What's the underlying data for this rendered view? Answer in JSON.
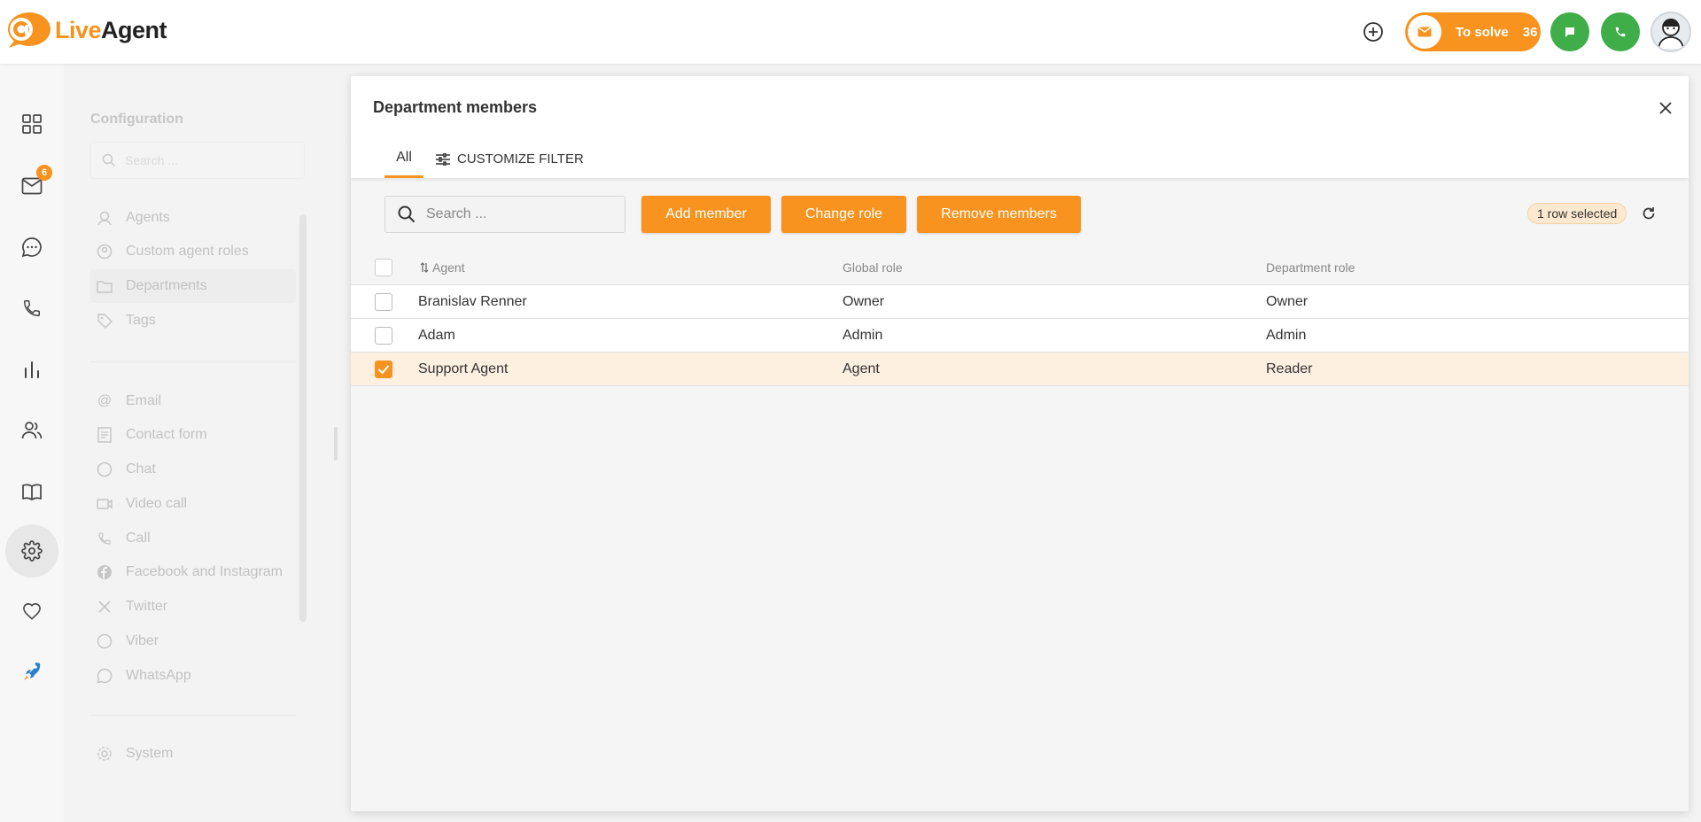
{
  "header": {
    "logo_live": "Live",
    "logo_agent": "Agent",
    "to_solve_label": "To solve",
    "to_solve_count": "36"
  },
  "rail": {
    "inbox_badge": "6",
    "items": [
      "dashboard-icon",
      "inbox-icon",
      "chat-icon",
      "phone-icon",
      "reports-icon",
      "contacts-icon",
      "knowledgebase-icon",
      "settings-icon",
      "heart-icon",
      "rocket-icon"
    ]
  },
  "config": {
    "title": "Configuration",
    "search_placeholder": "Search ...",
    "group1": [
      "Agents",
      "Custom agent roles",
      "Departments",
      "Tags"
    ],
    "group2": [
      "Email",
      "Contact form",
      "Chat",
      "Video call",
      "Call",
      "Facebook and Instagram",
      "Twitter",
      "Viber",
      "WhatsApp"
    ],
    "group3": [
      "System"
    ]
  },
  "modal": {
    "title": "Department members",
    "tab_all": "All",
    "customize_filter": "CUSTOMIZE FILTER",
    "search_placeholder": "Search ...",
    "add_member": "Add member",
    "change_role": "Change role",
    "remove_members": "Remove members",
    "rows_selected": "1 row selected"
  },
  "table": {
    "columns": [
      "Agent",
      "Global role",
      "Department role"
    ],
    "rows": [
      {
        "agent": "Branislav Renner",
        "global_role": "Owner",
        "department_role": "Owner",
        "selected": false
      },
      {
        "agent": "Adam",
        "global_role": "Admin",
        "department_role": "Admin",
        "selected": false
      },
      {
        "agent": "Support Agent",
        "global_role": "Agent",
        "department_role": "Reader",
        "selected": true
      }
    ]
  },
  "colors": {
    "accent": "#f7931e",
    "green": "#3fae49"
  }
}
